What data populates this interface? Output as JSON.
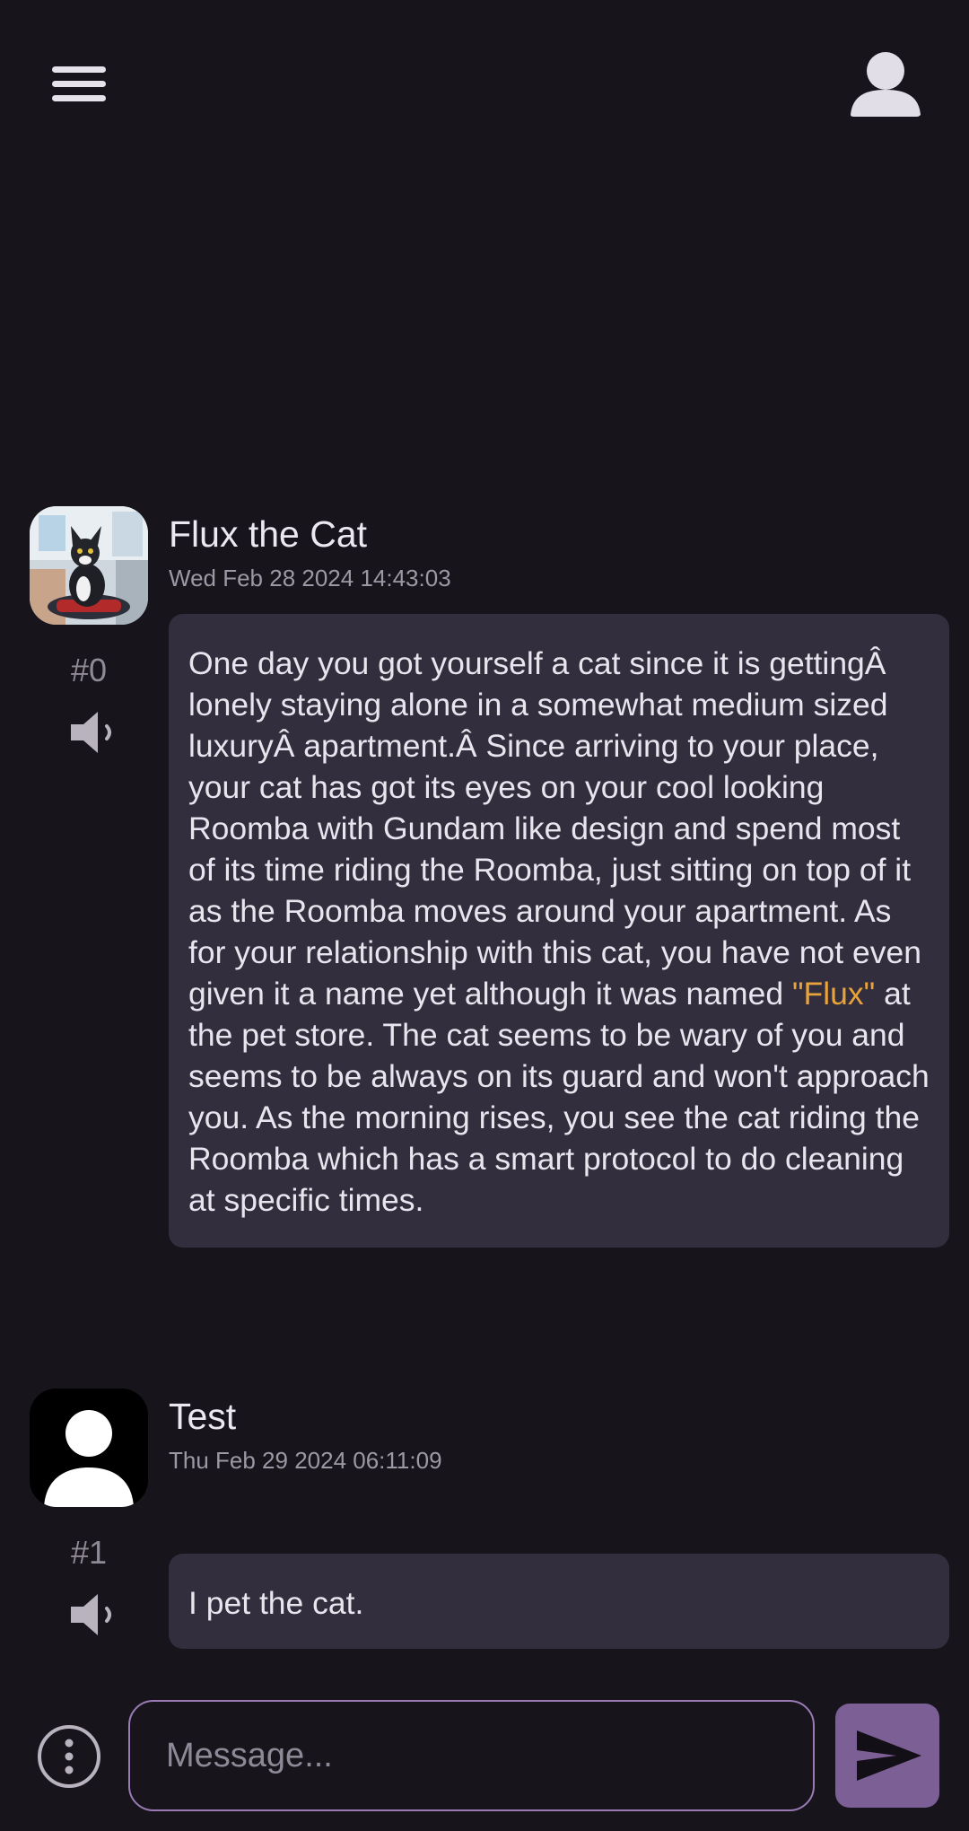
{
  "colors": {
    "background": "#17151b",
    "bubble": "#332e3d",
    "accent": "#7b5f95",
    "highlight": "#e8a33a"
  },
  "header": {
    "menu_icon": "hamburger-menu-icon",
    "profile_icon": "user-icon"
  },
  "messages": [
    {
      "sender": "Flux the Cat",
      "timestamp": "Wed Feb 28 2024 14:43:03",
      "index": "#0",
      "avatar": "cat-portrait",
      "text_before": "One day you got yourself a cat since it is gettingÂ lonely staying alone in a somewhat medium sized luxuryÂ apartment.Â Since arriving to your place, your cat has got its eyes on your cool looking Roomba with Gundam like design and spend most of its time riding the Roomba, just sitting on top of it as the Roomba moves around your apartment. As for your relationship with this cat, you have not even given it a name yet although it was named ",
      "highlight": "\"Flux\"",
      "text_after": " at the pet store. The cat seems to be wary of you and seems to be always on its guard and won't approach you. As the morning rises, you see the cat riding the Roomba which has a smart protocol to do cleaning at specific times."
    },
    {
      "sender": "Test",
      "timestamp": "Thu Feb 29 2024 06:11:09",
      "index": "#1",
      "avatar": "default-user-avatar",
      "text": "I pet the cat."
    }
  ],
  "composer": {
    "placeholder": "Message...",
    "value": "",
    "more_icon": "more-options-icon",
    "send_icon": "send-icon"
  }
}
